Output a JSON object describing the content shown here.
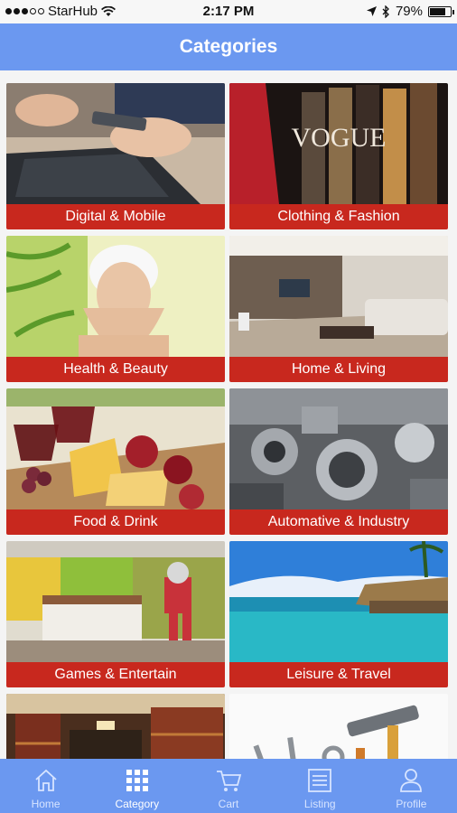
{
  "status": {
    "carrier": "StarHub",
    "time": "2:17 PM",
    "battery": "79%",
    "battery_level": 0.79
  },
  "header": {
    "title": "Categories"
  },
  "categories": [
    {
      "label": "Digital & Mobile",
      "icon": "laptop-phone-photo"
    },
    {
      "label": "Clothing & Fashion",
      "icon": "vogue-runway-photo"
    },
    {
      "label": "Health & Beauty",
      "icon": "spa-face-photo"
    },
    {
      "label": "Home & Living",
      "icon": "living-room-photo"
    },
    {
      "label": "Food & Drink",
      "icon": "wine-cheese-photo"
    },
    {
      "label": "Automative & Industry",
      "icon": "engine-photo"
    },
    {
      "label": "Games & Entertain",
      "icon": "game-room-photo"
    },
    {
      "label": "Leisure & Travel",
      "icon": "beach-resort-photo"
    },
    {
      "label": "",
      "icon": "bookshop-photo"
    },
    {
      "label": "",
      "icon": "tools-photo"
    }
  ],
  "tabs": [
    {
      "label": "Home",
      "icon": "home-icon"
    },
    {
      "label": "Category",
      "icon": "grid-icon"
    },
    {
      "label": "Cart",
      "icon": "cart-icon"
    },
    {
      "label": "Listing",
      "icon": "list-icon"
    },
    {
      "label": "Profile",
      "icon": "person-icon"
    }
  ],
  "colors": {
    "header": "#6b98f0",
    "label_bar": "#c8281e"
  }
}
